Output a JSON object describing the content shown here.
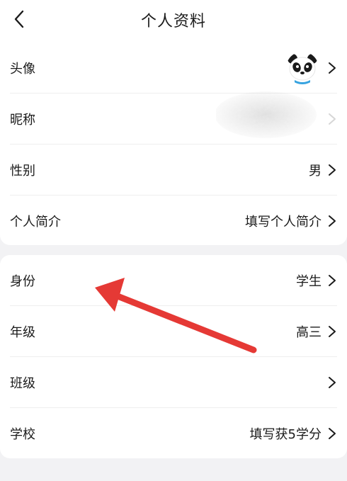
{
  "header": {
    "title": "个人资料",
    "back_icon": "chevron-left-icon"
  },
  "profile_card": {
    "avatar": {
      "label": "头像",
      "image": "panda-avatar"
    },
    "nickname": {
      "label": "昵称",
      "value": ""
    },
    "gender": {
      "label": "性别",
      "value": "男"
    },
    "bio": {
      "label": "个人简介",
      "value": "填写个人简介"
    }
  },
  "school_card": {
    "identity": {
      "label": "身份",
      "value": "学生"
    },
    "grade": {
      "label": "年级",
      "value": "高三"
    },
    "class": {
      "label": "班级",
      "value": ""
    },
    "school": {
      "label": "学校",
      "value": "填写获5学分"
    }
  },
  "annotation": {
    "color": "#e53935"
  }
}
